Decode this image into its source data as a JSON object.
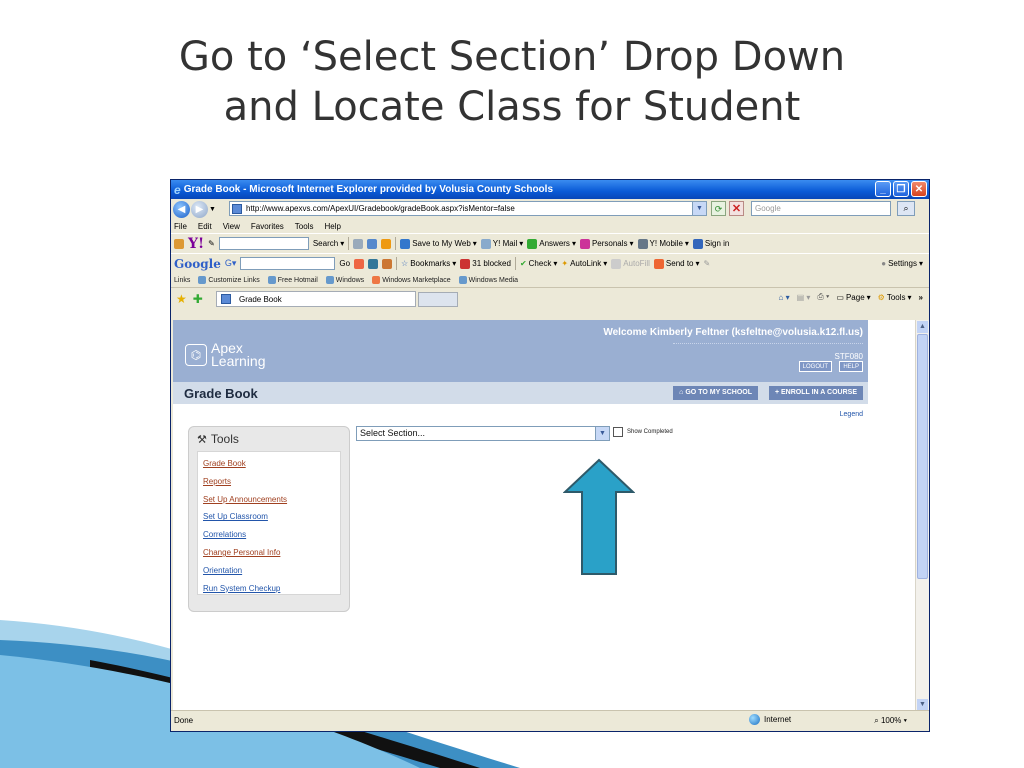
{
  "slide": {
    "title_line1": "Go to ‘Select Section’ Drop Down",
    "title_line2": "and Locate Class for Student"
  },
  "browser": {
    "window_title": "Grade Book - Microsoft Internet Explorer provided by Volusia County Schools",
    "address": "http://www.apexvs.com/ApexUI/Gradebook/gradeBook.aspx?isMentor=false",
    "search_placeholder": "Google",
    "menu": [
      "File",
      "Edit",
      "View",
      "Favorites",
      "Tools",
      "Help"
    ],
    "yahoo_toolbar": {
      "search_label": "Search",
      "save_label": "Save to My Web",
      "mail_label": "Y! Mail",
      "answers_label": "Answers",
      "personals_label": "Personals",
      "mobile_label": "Y! Mobile",
      "signin_label": "Sign in"
    },
    "google_toolbar": {
      "go_label": "Go",
      "bookmarks_label": "Bookmarks",
      "blocked_label": "31 blocked",
      "check_label": "Check",
      "autolink_label": "AutoLink",
      "autofill_label": "AutoFill",
      "sendto_label": "Send to",
      "settings_label": "Settings"
    },
    "links_bar": {
      "label": "Links",
      "items": [
        "Customize Links",
        "Free Hotmail",
        "Windows",
        "Windows Marketplace",
        "Windows Media"
      ]
    },
    "tab_title": "Grade Book",
    "command_bar": {
      "page_label": "Page",
      "tools_label": "Tools"
    },
    "status": {
      "text": "Done",
      "zone": "Internet",
      "zoom": "100%"
    }
  },
  "apex": {
    "logo_line1": "Apex",
    "logo_line2": "Learning",
    "welcome": "Welcome Kimberly Feltner (ksfeltne@volusia.k12.fl.us)",
    "user_code": "STF080",
    "logout_label": "LOGOUT",
    "help_label": "HELP",
    "page_title": "Grade Book",
    "go_school_label": "GO TO MY SCHOOL",
    "enroll_label": "+ ENROLL IN A COURSE",
    "legend_label": "Legend",
    "tools": {
      "heading": "Tools",
      "items": [
        {
          "label": "Grade Book",
          "color": "#a04020"
        },
        {
          "label": "Reports",
          "color": "#a04020"
        },
        {
          "label": "Set Up Announcements",
          "color": "#a04020"
        },
        {
          "label": "Set Up Classroom",
          "color": "#2255aa"
        },
        {
          "label": "Correlations",
          "color": "#2255aa"
        },
        {
          "label": "Change Personal Info",
          "color": "#a04020"
        },
        {
          "label": "Orientation",
          "color": "#2255aa"
        },
        {
          "label": "Run System Checkup",
          "color": "#2255aa"
        }
      ]
    },
    "section_select_value": "Select Section...",
    "show_completed_label": "Show Completed"
  },
  "colors": {
    "arrow_fill": "#2aa1c8",
    "apex_header": "#9aafd2"
  }
}
